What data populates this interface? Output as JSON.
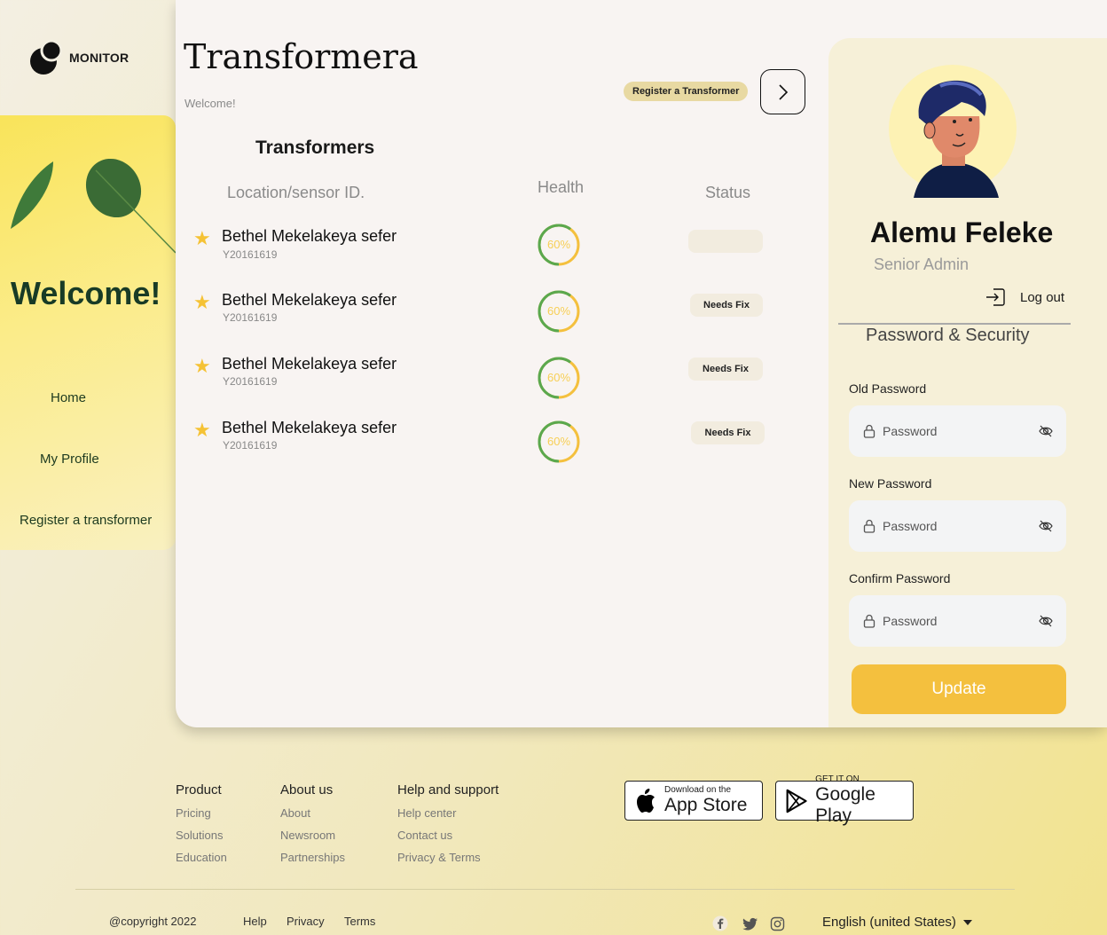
{
  "brand": {
    "name": "MONITOR"
  },
  "sidebar": {
    "welcome": "Welcome!",
    "items": [
      {
        "label": "Home"
      },
      {
        "label": "My Profile"
      },
      {
        "label": "Register a transformer"
      }
    ]
  },
  "header": {
    "title": "Transformera",
    "welcome": "Welcome!",
    "register_button": "Register a Transformer"
  },
  "transformers": {
    "title": "Transformers",
    "columns": [
      "Location/sensor ID.",
      "Health",
      "Status"
    ],
    "rows": [
      {
        "name": "Bethel Mekelakeya sefer",
        "id": "Y20161619",
        "health": "60%",
        "health_value": 60,
        "status": ""
      },
      {
        "name": "Bethel Mekelakeya sefer",
        "id": "Y20161619",
        "health": "60%",
        "health_value": 60,
        "status": "Needs Fix"
      },
      {
        "name": "Bethel Mekelakeya sefer",
        "id": "Y20161619",
        "health": "60%",
        "health_value": 60,
        "status": "Needs Fix"
      },
      {
        "name": "Bethel Mekelakeya sefer",
        "id": "Y20161619",
        "health": "60%",
        "health_value": 60,
        "status": "Needs Fix"
      }
    ]
  },
  "profile": {
    "name": "Alemu Feleke",
    "role": "Senior Admin",
    "logout": "Log out",
    "section_title": "Password & Security",
    "fields": [
      {
        "label": "Old Password",
        "placeholder": "Password"
      },
      {
        "label": "New Password",
        "placeholder": "Password"
      },
      {
        "label": "Confirm Password",
        "placeholder": "Password"
      }
    ],
    "update_button": "Update"
  },
  "footer": {
    "columns": [
      {
        "head": "Product",
        "links": [
          "Pricing",
          "Solutions",
          "Education"
        ]
      },
      {
        "head": "About us",
        "links": [
          "About",
          "Newsroom",
          "Partnerships"
        ]
      },
      {
        "head": "Help and support",
        "links": [
          "Help center",
          "Contact us",
          "Privacy & Terms"
        ]
      }
    ],
    "app_store": {
      "small": "Download on the",
      "big": "App Store"
    },
    "google_play": {
      "small": "GET IT ON",
      "big": "Google Play"
    },
    "copyright": "@copyright 2022",
    "bottom_links": [
      "Help",
      "Privacy",
      "Terms"
    ],
    "language": "English (united States)"
  },
  "colors": {
    "accent": "#f4c03e",
    "health_ring": "#5aa84e",
    "sidebar_bg": "#f9e45a"
  }
}
